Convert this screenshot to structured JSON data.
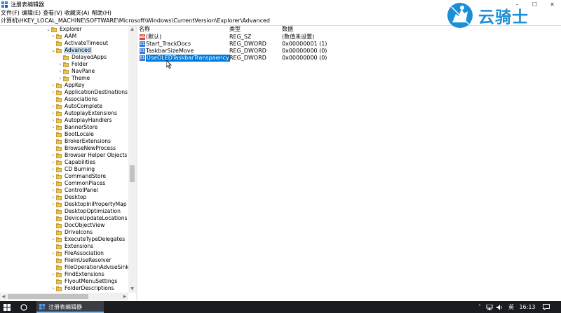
{
  "window": {
    "title": "注册表编辑器"
  },
  "window_controls": {
    "minimize": "–",
    "maximize": "☐",
    "close": "✕"
  },
  "menu": [
    "文件(F)",
    "编辑(E)",
    "查看(V)",
    "收藏夹(A)",
    "帮助(H)"
  ],
  "address": "计算机\\HKEY_LOCAL_MACHINE\\SOFTWARE\\Microsoft\\Windows\\CurrentVersion\\Explorer\\Advanced",
  "tree": [
    {
      "label": "Explorer",
      "arrow": "⌄",
      "level": 1
    },
    {
      "label": "AAM",
      "arrow": "›",
      "level": 2
    },
    {
      "label": "ActivateTimeout",
      "arrow": "",
      "level": 2
    },
    {
      "label": "Advanced",
      "arrow": "⌄",
      "level": 2,
      "selected": true
    },
    {
      "label": "DelayedApps",
      "arrow": "",
      "level": 3
    },
    {
      "label": "Folder",
      "arrow": "›",
      "level": 3
    },
    {
      "label": "NavPane",
      "arrow": "›",
      "level": 3
    },
    {
      "label": "Theme",
      "arrow": "›",
      "level": 3
    },
    {
      "label": "AppKey",
      "arrow": "›",
      "level": 2
    },
    {
      "label": "ApplicationDestinations",
      "arrow": "›",
      "level": 2
    },
    {
      "label": "Associations",
      "arrow": "",
      "level": 2
    },
    {
      "label": "AutoComplete",
      "arrow": "›",
      "level": 2
    },
    {
      "label": "AutoplayExtensions",
      "arrow": "›",
      "level": 2
    },
    {
      "label": "AutoplayHandlers",
      "arrow": "›",
      "level": 2
    },
    {
      "label": "BannerStore",
      "arrow": "›",
      "level": 2
    },
    {
      "label": "BootLocale",
      "arrow": "",
      "level": 2
    },
    {
      "label": "BrokerExtensions",
      "arrow": "",
      "level": 2
    },
    {
      "label": "BrowseNewProcess",
      "arrow": "",
      "level": 2
    },
    {
      "label": "Browser Helper Objects",
      "arrow": "›",
      "level": 2
    },
    {
      "label": "Capabilities",
      "arrow": "›",
      "level": 2
    },
    {
      "label": "CD Burning",
      "arrow": "›",
      "level": 2
    },
    {
      "label": "CommandStore",
      "arrow": "›",
      "level": 2
    },
    {
      "label": "CommonPlaces",
      "arrow": "›",
      "level": 2
    },
    {
      "label": "ControlPanel",
      "arrow": "›",
      "level": 2
    },
    {
      "label": "Desktop",
      "arrow": "›",
      "level": 2
    },
    {
      "label": "DesktopIniPropertyMap",
      "arrow": "›",
      "level": 2
    },
    {
      "label": "DesktopOptimization",
      "arrow": "",
      "level": 2
    },
    {
      "label": "DeviceUpdateLocations",
      "arrow": "",
      "level": 2
    },
    {
      "label": "DocObjectView",
      "arrow": "",
      "level": 2
    },
    {
      "label": "DriveIcons",
      "arrow": "",
      "level": 2
    },
    {
      "label": "ExecuteTypeDelegates",
      "arrow": "›",
      "level": 2
    },
    {
      "label": "Extensions",
      "arrow": "",
      "level": 2
    },
    {
      "label": "FileAssociation",
      "arrow": "›",
      "level": 2
    },
    {
      "label": "FileInUseResolver",
      "arrow": "",
      "level": 2
    },
    {
      "label": "FileOperationAdviseSinks",
      "arrow": "",
      "level": 2
    },
    {
      "label": "FindExtensions",
      "arrow": "›",
      "level": 2
    },
    {
      "label": "FlyoutMenuSettings",
      "arrow": "",
      "level": 2
    },
    {
      "label": "FolderDescriptions",
      "arrow": "›",
      "level": 2
    }
  ],
  "values_header": {
    "name": "名称",
    "type": "类型",
    "data": "数据"
  },
  "values": [
    {
      "icon": "ab",
      "name": "(默认)",
      "type": "REG_SZ",
      "data": "(数值未设置)"
    },
    {
      "icon": "bin",
      "name": "Start_TrackDocs",
      "type": "REG_DWORD",
      "data": "0x00000001 (1)"
    },
    {
      "icon": "bin",
      "name": "TaskbarSizeMove",
      "type": "REG_DWORD",
      "data": "0x00000000 (0)"
    },
    {
      "icon": "bin",
      "name": "UseOLEDTaskbarTranspaency",
      "type": "REG_DWORD",
      "data": "0x00000000 (0)",
      "selected": true
    }
  ],
  "watermark": {
    "text": "云骑士"
  },
  "taskbar": {
    "app_label": "注册表编辑器",
    "ime": "英",
    "time": "16:13"
  },
  "colors": {
    "selection": "#0078d7",
    "tree_selection": "#cce4f7",
    "taskbar": "#1a1c21",
    "watermark": "#1a8fd8"
  }
}
